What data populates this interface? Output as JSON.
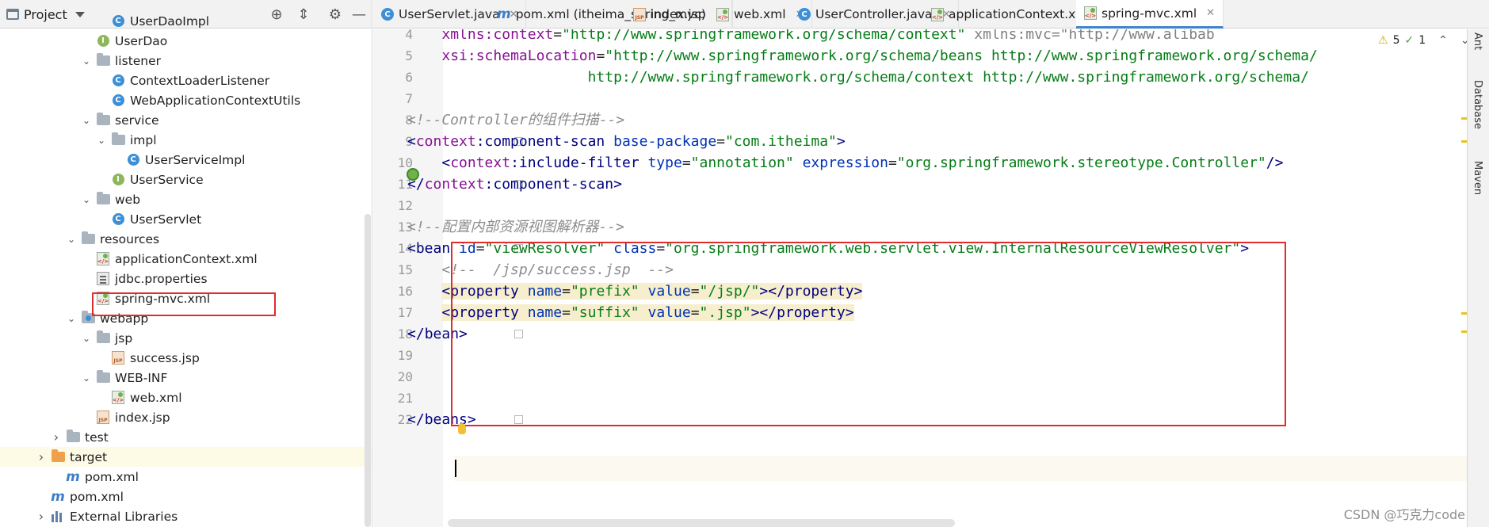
{
  "project_panel": {
    "title": "Project",
    "tree": [
      {
        "label": "UserDaoImpl",
        "icon": "class-icon",
        "depth": 4
      },
      {
        "label": "UserDao",
        "icon": "interface-icon",
        "depth": 3
      },
      {
        "label": "listener",
        "icon": "folder-icon",
        "depth": 3,
        "expanded": true
      },
      {
        "label": "ContextLoaderListener",
        "icon": "class-icon",
        "depth": 4
      },
      {
        "label": "WebApplicationContextUtils",
        "icon": "class-icon",
        "depth": 4
      },
      {
        "label": "service",
        "icon": "folder-icon",
        "depth": 3,
        "expanded": true
      },
      {
        "label": "impl",
        "icon": "folder-icon",
        "depth": 4,
        "expanded": true
      },
      {
        "label": "UserServiceImpl",
        "icon": "class-icon",
        "depth": 5
      },
      {
        "label": "UserService",
        "icon": "interface-icon",
        "depth": 4
      },
      {
        "label": "web",
        "icon": "folder-icon",
        "depth": 3,
        "expanded": true
      },
      {
        "label": "UserServlet",
        "icon": "class-icon",
        "depth": 4
      },
      {
        "label": "resources",
        "icon": "resources-folder-icon",
        "depth": 2,
        "expanded": true
      },
      {
        "label": "applicationContext.xml",
        "icon": "spring-xml-icon",
        "depth": 3
      },
      {
        "label": "jdbc.properties",
        "icon": "properties-icon",
        "depth": 3
      },
      {
        "label": "spring-mvc.xml",
        "icon": "spring-xml-icon",
        "depth": 3
      },
      {
        "label": "webapp",
        "icon": "web-folder-icon",
        "depth": 2,
        "expanded": true
      },
      {
        "label": "jsp",
        "icon": "folder-icon",
        "depth": 3,
        "expanded": true
      },
      {
        "label": "success.jsp",
        "icon": "jsp-icon",
        "depth": 4
      },
      {
        "label": "WEB-INF",
        "icon": "folder-icon",
        "depth": 3,
        "expanded": true
      },
      {
        "label": "web.xml",
        "icon": "xml-icon",
        "depth": 4
      },
      {
        "label": "index.jsp",
        "icon": "jsp-icon",
        "depth": 3
      },
      {
        "label": "test",
        "icon": "folder-icon",
        "depth": 1,
        "expanded": false
      },
      {
        "label": "target",
        "icon": "excluded-folder-icon",
        "depth": 0,
        "expanded": false,
        "highlighted": true
      },
      {
        "label": "pom.xml",
        "icon": "maven-icon",
        "depth": 1
      },
      {
        "label": "pom.xml",
        "icon": "maven-icon",
        "depth": 0
      },
      {
        "label": "External Libraries",
        "icon": "library-icon",
        "depth": 0,
        "expanded": false
      }
    ]
  },
  "tabs": [
    {
      "label": "UserServlet.java",
      "icon": "class-icon"
    },
    {
      "label": "pom.xml (itheima_spring_mvc)",
      "icon": "maven-icon"
    },
    {
      "label": "index.jsp",
      "icon": "jsp-icon"
    },
    {
      "label": "web.xml",
      "icon": "xml-icon"
    },
    {
      "label": "UserController.java",
      "icon": "class-icon"
    },
    {
      "label": "applicationContext.xml",
      "icon": "spring-xml-icon"
    },
    {
      "label": "spring-mvc.xml",
      "icon": "spring-xml-icon",
      "active": true
    }
  ],
  "editor": {
    "lines": [
      {
        "n": "4",
        "segs": [
          [
            "    ",
            ""
          ],
          [
            "xmlns:",
            "ns"
          ],
          [
            "context",
            "ns"
          ],
          [
            "=",
            ""
          ],
          [
            "\"http://www.springframework.org/schema/context\"",
            "str"
          ],
          [
            " ",
            ""
          ],
          [
            "xmlns:mvc=\"http://www.alibab",
            "grey"
          ]
        ]
      },
      {
        "n": "5",
        "segs": [
          [
            "    ",
            ""
          ],
          [
            "xsi:",
            "ns"
          ],
          [
            "schemaLocation",
            "ns"
          ],
          [
            "=",
            ""
          ],
          [
            "\"http://www.springframework.org/schema/beans http://www.springframework.org/schema/",
            "str"
          ]
        ]
      },
      {
        "n": "6",
        "segs": [
          [
            "                     ",
            ""
          ],
          [
            "http://www.springframework.org/schema/context http://www.springframework.org/schema/",
            "str"
          ]
        ]
      },
      {
        "n": "7",
        "segs": []
      },
      {
        "n": "8",
        "segs": [
          [
            "<!--Controller的组件扫描-->",
            "cm"
          ]
        ]
      },
      {
        "n": "9",
        "segs": [
          [
            "<",
            "tag"
          ],
          [
            "context",
            "ns"
          ],
          [
            ":component-scan",
            "tag"
          ],
          [
            " ",
            ""
          ],
          [
            "base-package",
            "attr"
          ],
          [
            "=",
            ""
          ],
          [
            "\"com.itheima\"",
            "str"
          ],
          [
            ">",
            "tag"
          ]
        ]
      },
      {
        "n": "10",
        "segs": [
          [
            "    ",
            ""
          ],
          [
            "<",
            "tag"
          ],
          [
            "context",
            "ns"
          ],
          [
            ":include-filter",
            "tag"
          ],
          [
            " ",
            ""
          ],
          [
            "type",
            "attr"
          ],
          [
            "=",
            ""
          ],
          [
            "\"annotation\"",
            "str"
          ],
          [
            " ",
            ""
          ],
          [
            "expression",
            "attr"
          ],
          [
            "=",
            ""
          ],
          [
            "\"org.springframework.stereotype.Controller\"",
            "str"
          ],
          [
            "/>",
            "tag"
          ]
        ]
      },
      {
        "n": "11",
        "segs": [
          [
            "</",
            "tag"
          ],
          [
            "context",
            "ns"
          ],
          [
            ":component-scan",
            "tag"
          ],
          [
            ">",
            "tag"
          ]
        ]
      },
      {
        "n": "12",
        "segs": []
      },
      {
        "n": "13",
        "segs": [
          [
            "<!--配置内部资源视图解析器-->",
            "cm"
          ]
        ]
      },
      {
        "n": "14",
        "segs": [
          [
            "<",
            "tag"
          ],
          [
            "bean",
            "tag"
          ],
          [
            " ",
            ""
          ],
          [
            "id",
            "attr"
          ],
          [
            "=",
            ""
          ],
          [
            "\"viewResolver\"",
            "str"
          ],
          [
            " ",
            ""
          ],
          [
            "class",
            "attr"
          ],
          [
            "=",
            ""
          ],
          [
            "\"org.springframework.web.servlet.view.InternalResourceViewResolver\"",
            "str"
          ],
          [
            ">",
            "tag"
          ]
        ]
      },
      {
        "n": "15",
        "segs": [
          [
            "    ",
            ""
          ],
          [
            "<!--  /jsp/success.jsp  -->",
            "cm"
          ]
        ]
      },
      {
        "n": "16",
        "segs": [
          [
            "    ",
            ""
          ],
          [
            "<",
            "tag hl"
          ],
          [
            "property",
            "tag hl"
          ],
          [
            " ",
            "hl"
          ],
          [
            "name",
            "attr hl"
          ],
          [
            "=",
            "hl"
          ],
          [
            "\"prefix\"",
            "str hl"
          ],
          [
            " ",
            "hl"
          ],
          [
            "value",
            "attr hl"
          ],
          [
            "=",
            "hl"
          ],
          [
            "\"/jsp/\"",
            "str hl"
          ],
          [
            "></",
            "tag hl"
          ],
          [
            "property",
            "tag hl"
          ],
          [
            ">",
            "tag hl"
          ]
        ]
      },
      {
        "n": "17",
        "segs": [
          [
            "    ",
            ""
          ],
          [
            "<",
            "tag hl"
          ],
          [
            "property",
            "tag hl"
          ],
          [
            " ",
            "hl"
          ],
          [
            "name",
            "attr hl"
          ],
          [
            "=",
            "hl"
          ],
          [
            "\"suffix\"",
            "str hl"
          ],
          [
            " ",
            "hl"
          ],
          [
            "value",
            "attr hl"
          ],
          [
            "=",
            "hl"
          ],
          [
            "\".jsp\"",
            "str hl"
          ],
          [
            "></",
            "tag hl"
          ],
          [
            "property",
            "tag hl"
          ],
          [
            ">",
            "tag hl"
          ]
        ]
      },
      {
        "n": "18",
        "segs": [
          [
            "</",
            "tag"
          ],
          [
            "bean",
            "tag"
          ],
          [
            ">",
            "tag"
          ]
        ]
      },
      {
        "n": "19",
        "segs": []
      },
      {
        "n": "20",
        "segs": []
      },
      {
        "n": "21",
        "segs": []
      },
      {
        "n": "22",
        "segs": [
          [
            "</",
            "tag"
          ],
          [
            "beans",
            "tag"
          ],
          [
            ">",
            "tag"
          ]
        ]
      }
    ],
    "inspections": {
      "warnings": "5",
      "ok": "1"
    }
  },
  "right_tools": [
    "Ant",
    "Database",
    "Maven"
  ],
  "watermark": "CSDN @巧克力code"
}
